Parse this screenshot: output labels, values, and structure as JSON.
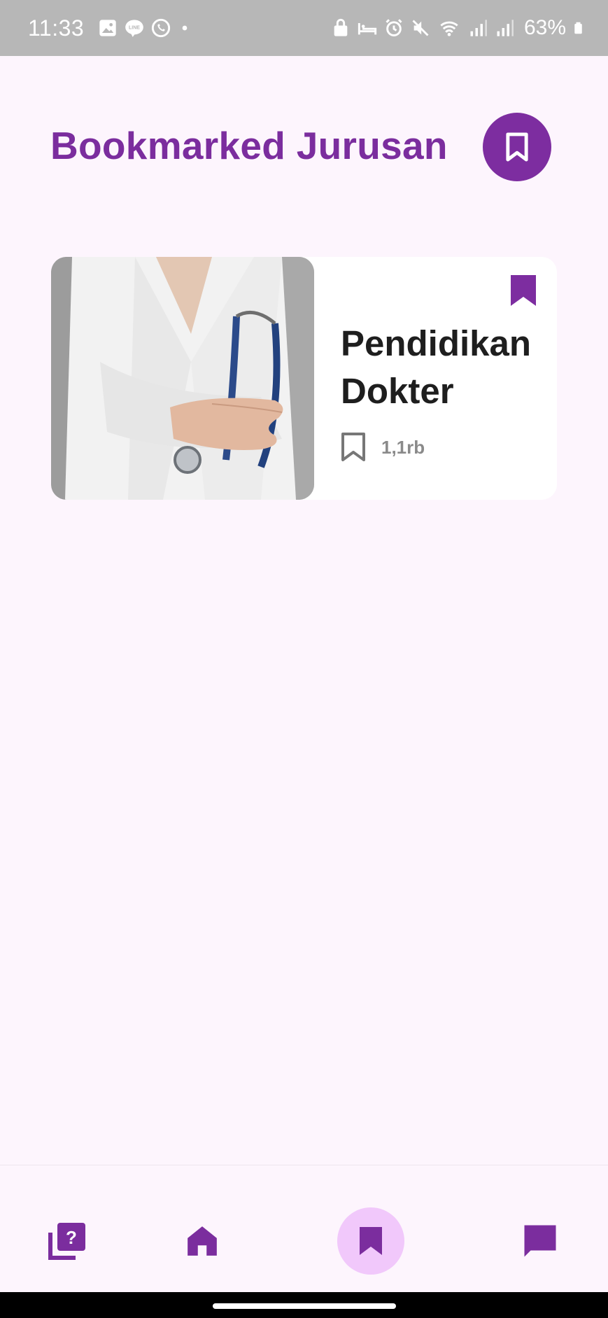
{
  "status_bar": {
    "time": "11:33",
    "battery": "63%",
    "icons_left": [
      "gallery-icon",
      "line-icon",
      "whatsapp-icon",
      "dot-icon"
    ],
    "icons_right": [
      "lock-icon",
      "bed-icon",
      "alarm-icon",
      "mute-icon",
      "wifi-icon",
      "signal-icon",
      "signal-icon",
      "battery-icon"
    ]
  },
  "header": {
    "title": "Bookmarked Jurusan",
    "action_icon": "bookmark-outline-icon"
  },
  "bookmarks": [
    {
      "title_line1": "Pendidikan",
      "title_line2": "Dokter",
      "count": "1,1rb",
      "image": "doctor-with-stethoscope-photo",
      "bookmarked": true
    }
  ],
  "bottom_nav": {
    "items": [
      {
        "name": "quiz",
        "icon": "quiz-icon",
        "active": false
      },
      {
        "name": "home",
        "icon": "home-icon",
        "active": false
      },
      {
        "name": "bookmark",
        "icon": "bookmark-icon",
        "active": true
      },
      {
        "name": "chat",
        "icon": "chat-icon",
        "active": false
      }
    ]
  },
  "colors": {
    "primary": "#7b2d9e",
    "active_pill": "#f1c8fb",
    "background": "#fdf5fd",
    "status_bar": "#b7b7b7"
  }
}
